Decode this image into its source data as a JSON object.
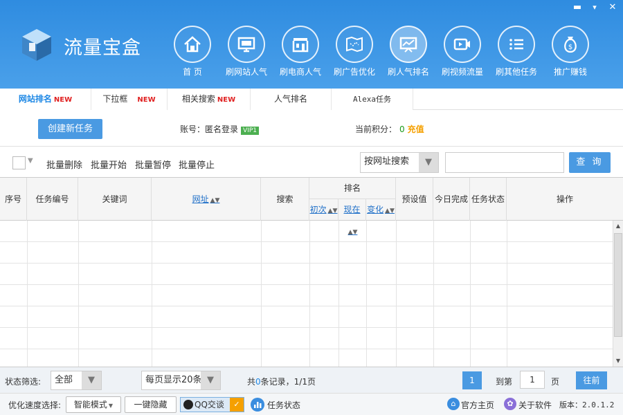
{
  "window": {
    "minimize": "▬",
    "close": "✕"
  },
  "app": {
    "title": "流量宝盒"
  },
  "nav": [
    {
      "label": "首 页",
      "icon": "home-icon"
    },
    {
      "label": "刷网站人气",
      "icon": "monitor-icon"
    },
    {
      "label": "刷电商人气",
      "icon": "store-icon"
    },
    {
      "label": "刷广告优化",
      "icon": "map-icon"
    },
    {
      "label": "刷人气排名",
      "icon": "chart-board-icon",
      "active": true
    },
    {
      "label": "刷视频流量",
      "icon": "video-icon"
    },
    {
      "label": "刷其他任务",
      "icon": "list-icon"
    },
    {
      "label": "推广赚钱",
      "icon": "money-bag-icon"
    }
  ],
  "tabs": [
    {
      "label": "网站排名",
      "new": "NEW",
      "active": true
    },
    {
      "label": "下拉框",
      "new": "NEW"
    },
    {
      "label": "相关搜索",
      "new": "NEW"
    },
    {
      "label": "人气排名",
      "new": ""
    },
    {
      "label": "Alexa任务",
      "new": ""
    }
  ],
  "task_area": {
    "create_button": "创建新任务",
    "account_label": "账号：匿名登录",
    "vip": "VIP1",
    "points_label": "当前积分：",
    "points_value": "0",
    "recharge": "充值"
  },
  "toolbar": {
    "bulk_delete": "批量删除",
    "bulk_start": "批量开始",
    "bulk_pause": "批量暂停",
    "bulk_stop": "批量停止",
    "search_mode": "按网址搜索",
    "search_value": "",
    "query_button": "查 询"
  },
  "table": {
    "headers": {
      "index": "序号",
      "task_id": "任务编号",
      "keyword": "关键词",
      "url": "网址",
      "search": "搜索",
      "rank": "排名",
      "rank_initial": "初次",
      "rank_now": "现在",
      "rank_change": "变化",
      "preset": "预设值",
      "today_done": "今日完成",
      "status": "任务状态",
      "action": "操作"
    },
    "rows": []
  },
  "footer": {
    "status_filter_label": "状态筛选:",
    "status_filter_value": "全部",
    "page_size": "每页显示20条",
    "records_prefix": "共",
    "records_count": "0",
    "records_suffix": "条记录，1/1页",
    "current_page": "1",
    "goto_label": "到第",
    "goto_value": "1",
    "page_unit": "页",
    "go_button": "往前"
  },
  "statusbar": {
    "speed_label": "优化速度选择:",
    "speed_value": "智能模式",
    "hide_button": "一键隐藏",
    "qq_button": "QQ交谈",
    "task_status": "任务状态",
    "home_link": "官方主页",
    "about_link": "关于软件",
    "version": "版本：2.0.1.2"
  },
  "colors": {
    "header_blue": "#3a94e4",
    "accent": "#1e88e5",
    "new_red": "#e02020",
    "vip_green": "#4caf50",
    "recharge_orange": "#f5a000"
  }
}
